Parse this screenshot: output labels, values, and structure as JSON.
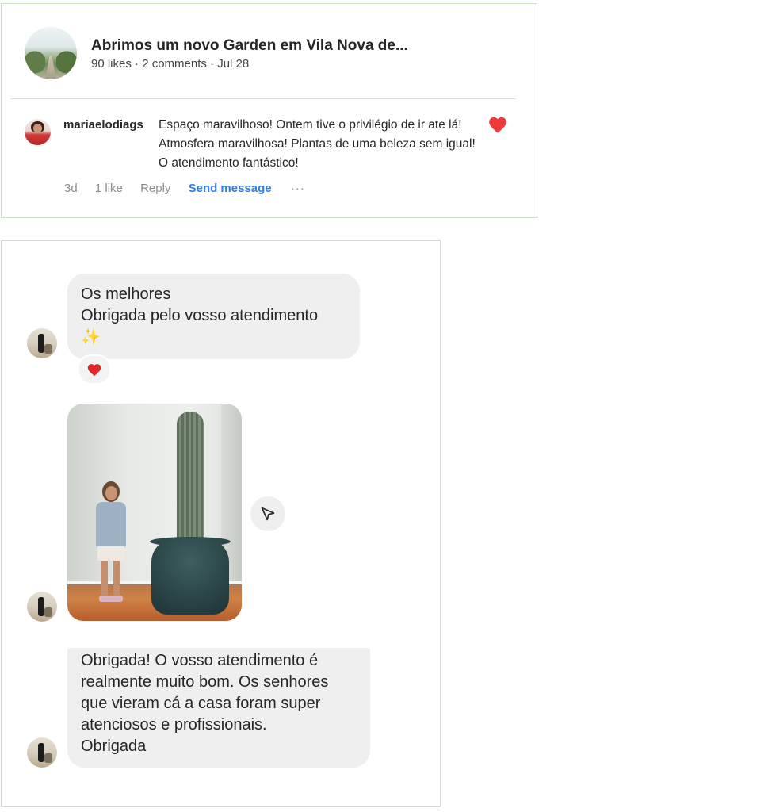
{
  "post": {
    "title": "Abrimos um novo Garden em Vila Nova de...",
    "meta": "90 likes · 2 comments · Jul 28"
  },
  "comment": {
    "username": "mariaelodiags",
    "text": "Espaço maravilhoso! Ontem tive o privilégio de ir ate lá! Atmosfera maravilhosa! Plantas de uma beleza sem igual! O atendimento fantástico!",
    "liked": true,
    "actions": {
      "time": "3d",
      "likes": "1 like",
      "reply": "Reply",
      "send_message": "Send message",
      "more": "···"
    },
    "colors": {
      "heart": "#ed3b3b",
      "send_message": "#2f80ed"
    }
  },
  "dm": {
    "messages": [
      {
        "lines": [
          "Os melhores",
          "Obrigada pelo vosso atendimento"
        ],
        "emoji": "✨",
        "reaction": "❤"
      },
      {
        "type": "photo",
        "share_icon": "paper-plane-icon"
      },
      {
        "lines": [
          "Obrigada! O vosso atendimento é",
          "realmente muito bom. Os senhores",
          "que vieram cá a casa foram super",
          "atenciosos e profissionais.",
          "Obrigada"
        ]
      }
    ],
    "colors": {
      "bubble": "#efefef",
      "reaction_heart": "#e0272b",
      "border": "#c9e3c2"
    }
  }
}
